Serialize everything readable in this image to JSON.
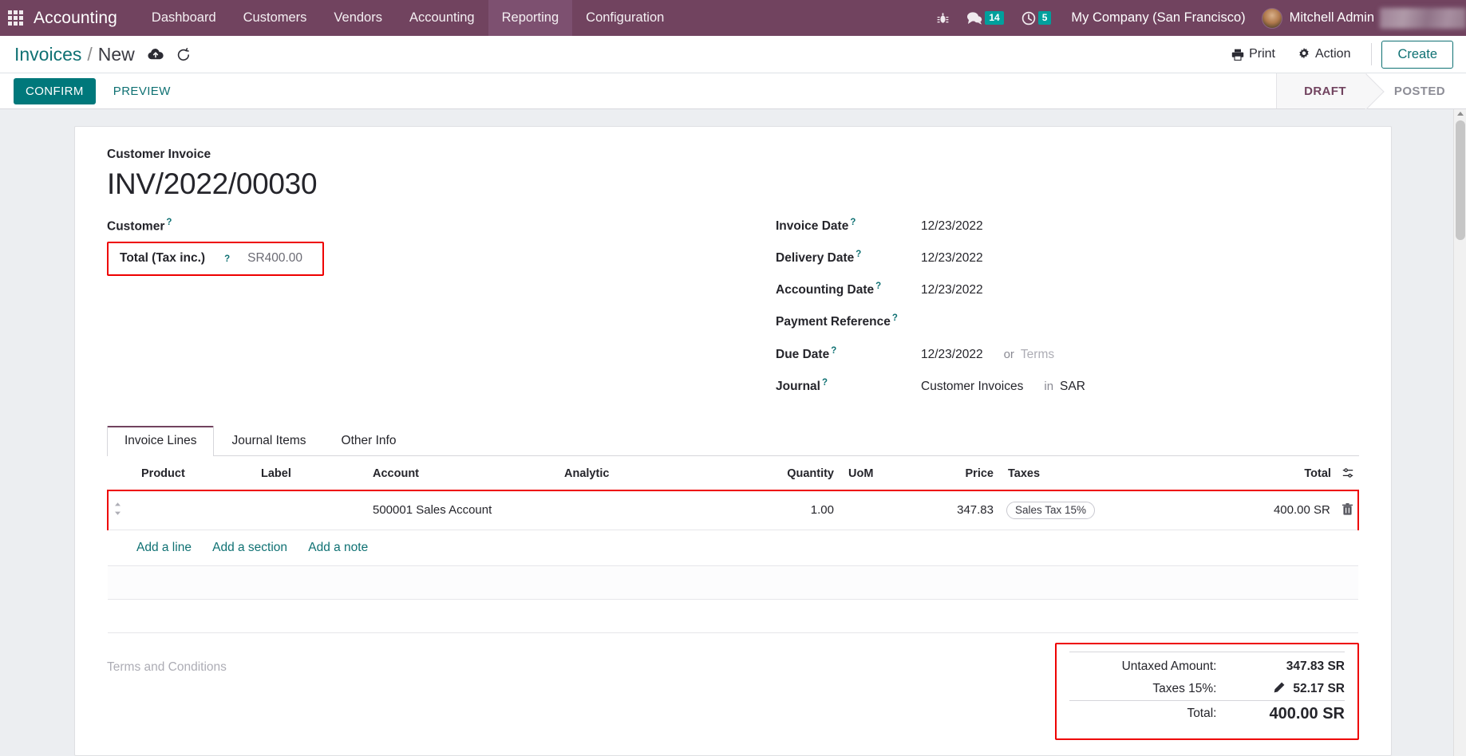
{
  "navbar": {
    "apps_icon": "apps-grid-icon",
    "brand": "Accounting",
    "menus": [
      {
        "label": "Dashboard",
        "active": false
      },
      {
        "label": "Customers",
        "active": false
      },
      {
        "label": "Vendors",
        "active": false
      },
      {
        "label": "Accounting",
        "active": false
      },
      {
        "label": "Reporting",
        "active": true
      },
      {
        "label": "Configuration",
        "active": false
      }
    ],
    "bug_icon": "bug-icon",
    "messages_icon": "chat-bubble-icon",
    "messages_count": "14",
    "activities_icon": "clock-icon",
    "activities_count": "5",
    "company": "My Company (San Francisco)",
    "user": "Mitchell Admin",
    "accent_purple": "#71435f",
    "badge_color": "#00a09d"
  },
  "control_panel": {
    "breadcrumb_root": "Invoices",
    "breadcrumb_sep": "/",
    "breadcrumb_current": "New",
    "save_icon": "cloud-upload-icon",
    "discard_icon": "undo-icon",
    "print_label": "Print",
    "print_icon": "printer-icon",
    "action_label": "Action",
    "action_icon": "gear-icon",
    "create_label": "Create",
    "teal": "#0f7173"
  },
  "statusbar": {
    "confirm_label": "CONFIRM",
    "preview_label": "PREVIEW",
    "stages": [
      {
        "label": "DRAFT",
        "active": true
      },
      {
        "label": "POSTED",
        "active": false
      }
    ],
    "confirm_bg": "#00787b"
  },
  "form": {
    "type_label": "Customer Invoice",
    "document_number": "INV/2022/00030",
    "customer_label": "Customer",
    "customer_value": "",
    "highlight_color": "#ee0000",
    "total_tax_inc": {
      "label": "Total (Tax inc.)",
      "value": "SR400.00",
      "highlighted": true
    },
    "right_fields": [
      {
        "label": "Invoice Date",
        "value": "12/23/2022",
        "suffix_label": "",
        "suffix_value": ""
      },
      {
        "label": "Delivery Date",
        "value": "12/23/2022",
        "suffix_label": "",
        "suffix_value": ""
      },
      {
        "label": "Accounting Date",
        "value": "12/23/2022",
        "suffix_label": "",
        "suffix_value": ""
      },
      {
        "label": "Payment Reference",
        "value": "",
        "suffix_label": "",
        "suffix_value": ""
      },
      {
        "label": "Due Date",
        "value": "12/23/2022",
        "suffix_label": "or",
        "suffix_value": "Terms"
      },
      {
        "label": "Journal",
        "value": "Customer Invoices",
        "suffix_label": "in",
        "suffix_value": "SAR"
      }
    ]
  },
  "notebook": {
    "tabs": [
      {
        "label": "Invoice Lines",
        "active": true
      },
      {
        "label": "Journal Items",
        "active": false
      },
      {
        "label": "Other Info",
        "active": false
      }
    ]
  },
  "lines_table": {
    "columns": [
      "Product",
      "Label",
      "Account",
      "Analytic",
      "Quantity",
      "UoM",
      "Price",
      "Taxes",
      "Total"
    ],
    "optional_columns_icon": "column-options-icon",
    "rows": [
      {
        "drag_handle": "drag-handle-icon",
        "product": "",
        "label": "",
        "account": "500001 Sales Account",
        "analytic": "",
        "quantity": "1.00",
        "uom": "",
        "price": "347.83",
        "taxes": "Sales Tax 15%",
        "total": "400.00 SR",
        "delete_icon": "trash-icon",
        "highlighted": true
      }
    ],
    "add_line": "Add a line",
    "add_section": "Add a section",
    "add_note": "Add a note"
  },
  "footer": {
    "terms_placeholder": "Terms and Conditions",
    "totals": [
      {
        "label": "Untaxed Amount:",
        "amount": "347.83 SR",
        "has_pencil": false,
        "grand": false
      },
      {
        "label": "Taxes 15%:",
        "amount": "52.17 SR",
        "has_pencil": true,
        "pencil_icon": "pencil-icon",
        "grand": false
      },
      {
        "label": "Total:",
        "amount": "400.00 SR",
        "has_pencil": false,
        "grand": true
      }
    ],
    "highlighted": true
  }
}
